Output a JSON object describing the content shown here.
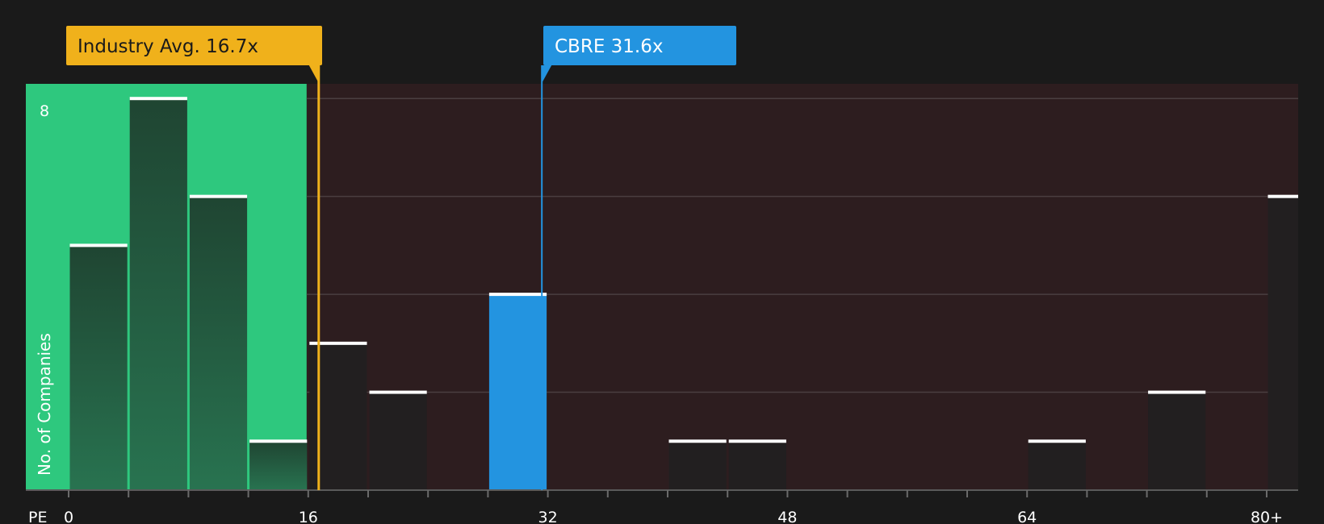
{
  "chart_data": {
    "type": "bar",
    "x_title": "PE",
    "y_title": "No. of Companies",
    "x_ticks": [
      "0",
      "16",
      "32",
      "48",
      "64",
      "80+"
    ],
    "y_tick_label": "8",
    "ylim": [
      0,
      8.3
    ],
    "bin_width": 4,
    "bins": [
      {
        "start": 0,
        "end": 4,
        "count": 5
      },
      {
        "start": 4,
        "end": 8,
        "count": 8
      },
      {
        "start": 8,
        "end": 12,
        "count": 6
      },
      {
        "start": 12,
        "end": 16,
        "count": 1
      },
      {
        "start": 16,
        "end": 20,
        "count": 3
      },
      {
        "start": 20,
        "end": 24,
        "count": 2
      },
      {
        "start": 28,
        "end": 32,
        "count": 4,
        "highlight": true
      },
      {
        "start": 40,
        "end": 44,
        "count": 1
      },
      {
        "start": 44,
        "end": 48,
        "count": 1
      },
      {
        "start": 64,
        "end": 68,
        "count": 1
      },
      {
        "start": 72,
        "end": 76,
        "count": 2
      },
      {
        "start": 80,
        "end": 84,
        "count": 6
      }
    ],
    "fair_range": [
      0,
      16
    ],
    "industry_avg": {
      "label": "Industry Avg. 16.7x",
      "value": 16.7
    },
    "company": {
      "label": "CBRE 31.6x",
      "value": 31.6
    },
    "colors": {
      "background": "#1a1a1a",
      "fair_zone": "#2ec87e",
      "over_zone": "#2d1d1f",
      "bar_in_fair": "#214a35",
      "bar_default": "#221f20",
      "bar_highlight": "#2394e0",
      "industry_avg": "#f0b11b",
      "company": "#2394e0",
      "cap": "#ffffff",
      "grid": "#4a3e40",
      "text": "#ffffff"
    }
  }
}
